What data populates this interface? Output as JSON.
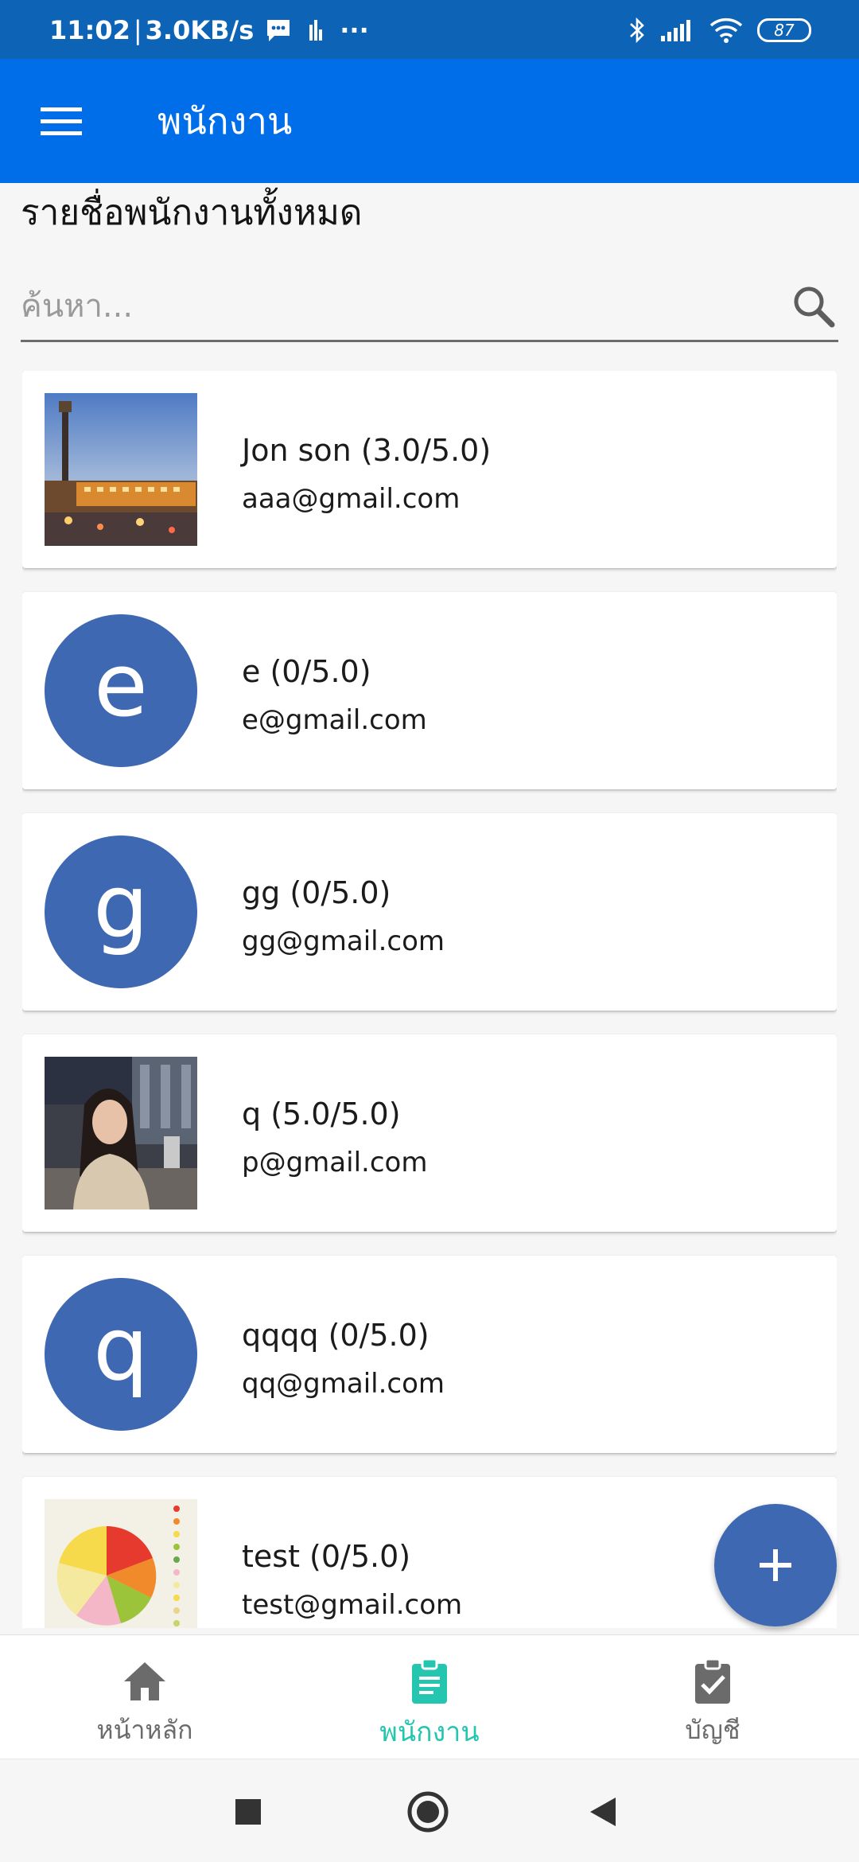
{
  "status_bar": {
    "time": "11:02",
    "speed": "3.0KB/s",
    "more": "···",
    "battery": "87"
  },
  "app_bar": {
    "title": "พนักงาน"
  },
  "page": {
    "section_title": "รายชื่อพนักงานทั้งหมด",
    "search_placeholder": "ค้นหา..."
  },
  "employees": [
    {
      "name": "Jon son (3.0/5.0)",
      "email": "aaa@gmail.com",
      "avatar_type": "photo-city"
    },
    {
      "name": "e (0/5.0)",
      "email": "e@gmail.com",
      "avatar_letter": "e"
    },
    {
      "name": "gg (0/5.0)",
      "email": "gg@gmail.com",
      "avatar_letter": "g"
    },
    {
      "name": "q (5.0/5.0)",
      "email": "p@gmail.com",
      "avatar_type": "photo-person"
    },
    {
      "name": "qqqq (0/5.0)",
      "email": "qq@gmail.com",
      "avatar_letter": "q"
    },
    {
      "name": "test (0/5.0)",
      "email": "test@gmail.com",
      "avatar_type": "photo-pie-chart"
    }
  ],
  "fab": {
    "icon": "plus-icon"
  },
  "bottom_nav": {
    "items": [
      {
        "label": "หน้าหลัก",
        "icon": "home-icon"
      },
      {
        "label": "พนักงาน",
        "icon": "clipboard-icon",
        "active": true
      },
      {
        "label": "บัญชี",
        "icon": "clipboard-check-icon"
      }
    ]
  },
  "colors": {
    "status_bar": "#0d63b6",
    "app_bar": "#006ee9",
    "avatar": "#3f68b2",
    "active_nav": "#25c6b0"
  }
}
